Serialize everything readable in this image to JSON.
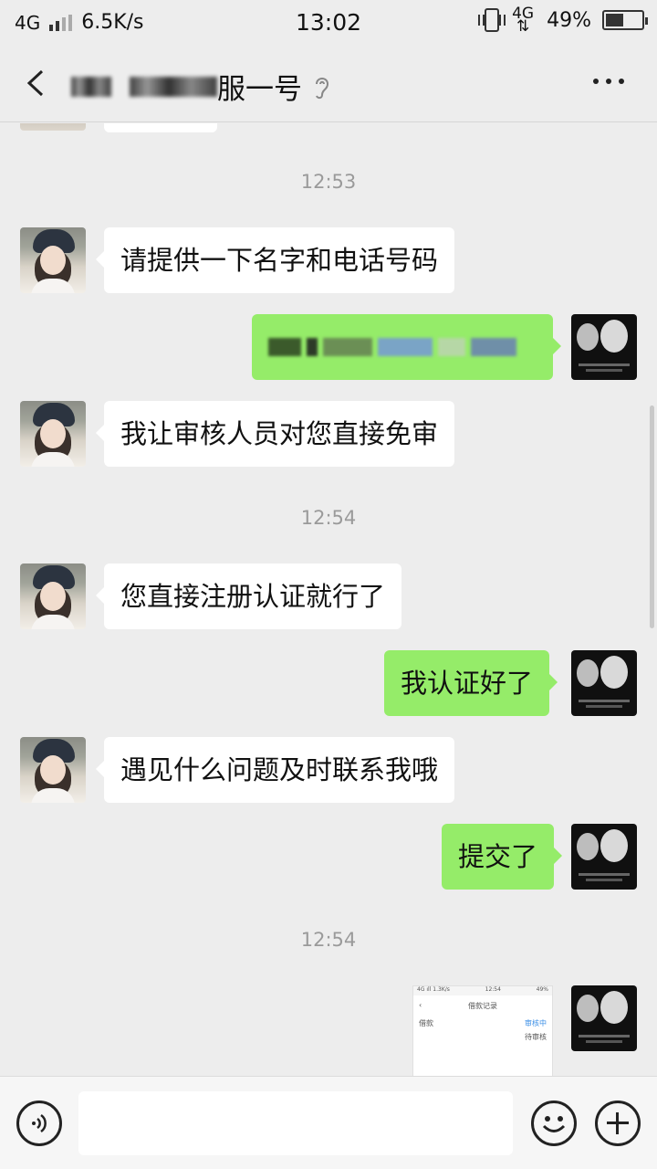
{
  "status_bar": {
    "network": "4G",
    "speed": "6.5K/s",
    "time": "13:02",
    "network_right": "4G",
    "battery": "49%",
    "battery_level": 0.49
  },
  "header": {
    "title_visible": "服一号",
    "back_icon": "chevron-left-icon",
    "ear_icon": "ear-icon",
    "more_icon": "more-dots-icon"
  },
  "messages": [
    {
      "type": "timestamp",
      "text": "12:53"
    },
    {
      "type": "in",
      "text": "请提供一下名字和电话号码"
    },
    {
      "type": "out-redacted"
    },
    {
      "type": "in",
      "text": "我让审核人员对您直接免审"
    },
    {
      "type": "timestamp",
      "text": "12:54"
    },
    {
      "type": "in",
      "text": "您直接注册认证就行了"
    },
    {
      "type": "out",
      "text": "我认证好了"
    },
    {
      "type": "in",
      "text": "遇见什么问题及时联系我哦"
    },
    {
      "type": "out",
      "text": "提交了"
    },
    {
      "type": "timestamp",
      "text": "12:54"
    },
    {
      "type": "out-image"
    }
  ],
  "timestamps": [
    "12:53",
    "12:54",
    "12:54"
  ],
  "incoming": [
    "请提供一下名字和电话号码",
    "我让审核人员对您直接免审",
    "您直接注册认证就行了",
    "遇见什么问题及时联系我哦"
  ],
  "outgoing": [
    "我认证好了",
    "提交了"
  ],
  "image_thumb": {
    "status_left": "4G ıll 1.3K/s",
    "status_time": "12:54",
    "status_right": "49%",
    "title": "借款记录",
    "row1_left": "借款",
    "row1_right": "审核中",
    "row2_left": "",
    "row2_right": "待审核"
  },
  "input_bar": {
    "voice_icon": "voice-icon",
    "placeholder": "",
    "emoji_icon": "emoji-icon",
    "plus_icon": "plus-icon"
  }
}
